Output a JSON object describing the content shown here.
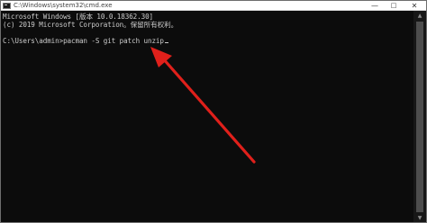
{
  "window": {
    "title": "C:\\Windows\\system32\\cmd.exe",
    "minimize_glyph": "—",
    "maximize_glyph": "□",
    "close_glyph": "✕"
  },
  "console": {
    "lines": [
      "Microsoft Windows [版本 10.0.18362.30]",
      "(c) 2019 Microsoft Corporation。保留所有权利。",
      "",
      "C:\\Users\\admin>pacman -S git patch unzip"
    ]
  },
  "scrollbar": {
    "up_glyph": "▲",
    "down_glyph": "▼"
  },
  "annotation": {
    "color": "#e0201b",
    "icon": "red-arrow-icon"
  }
}
